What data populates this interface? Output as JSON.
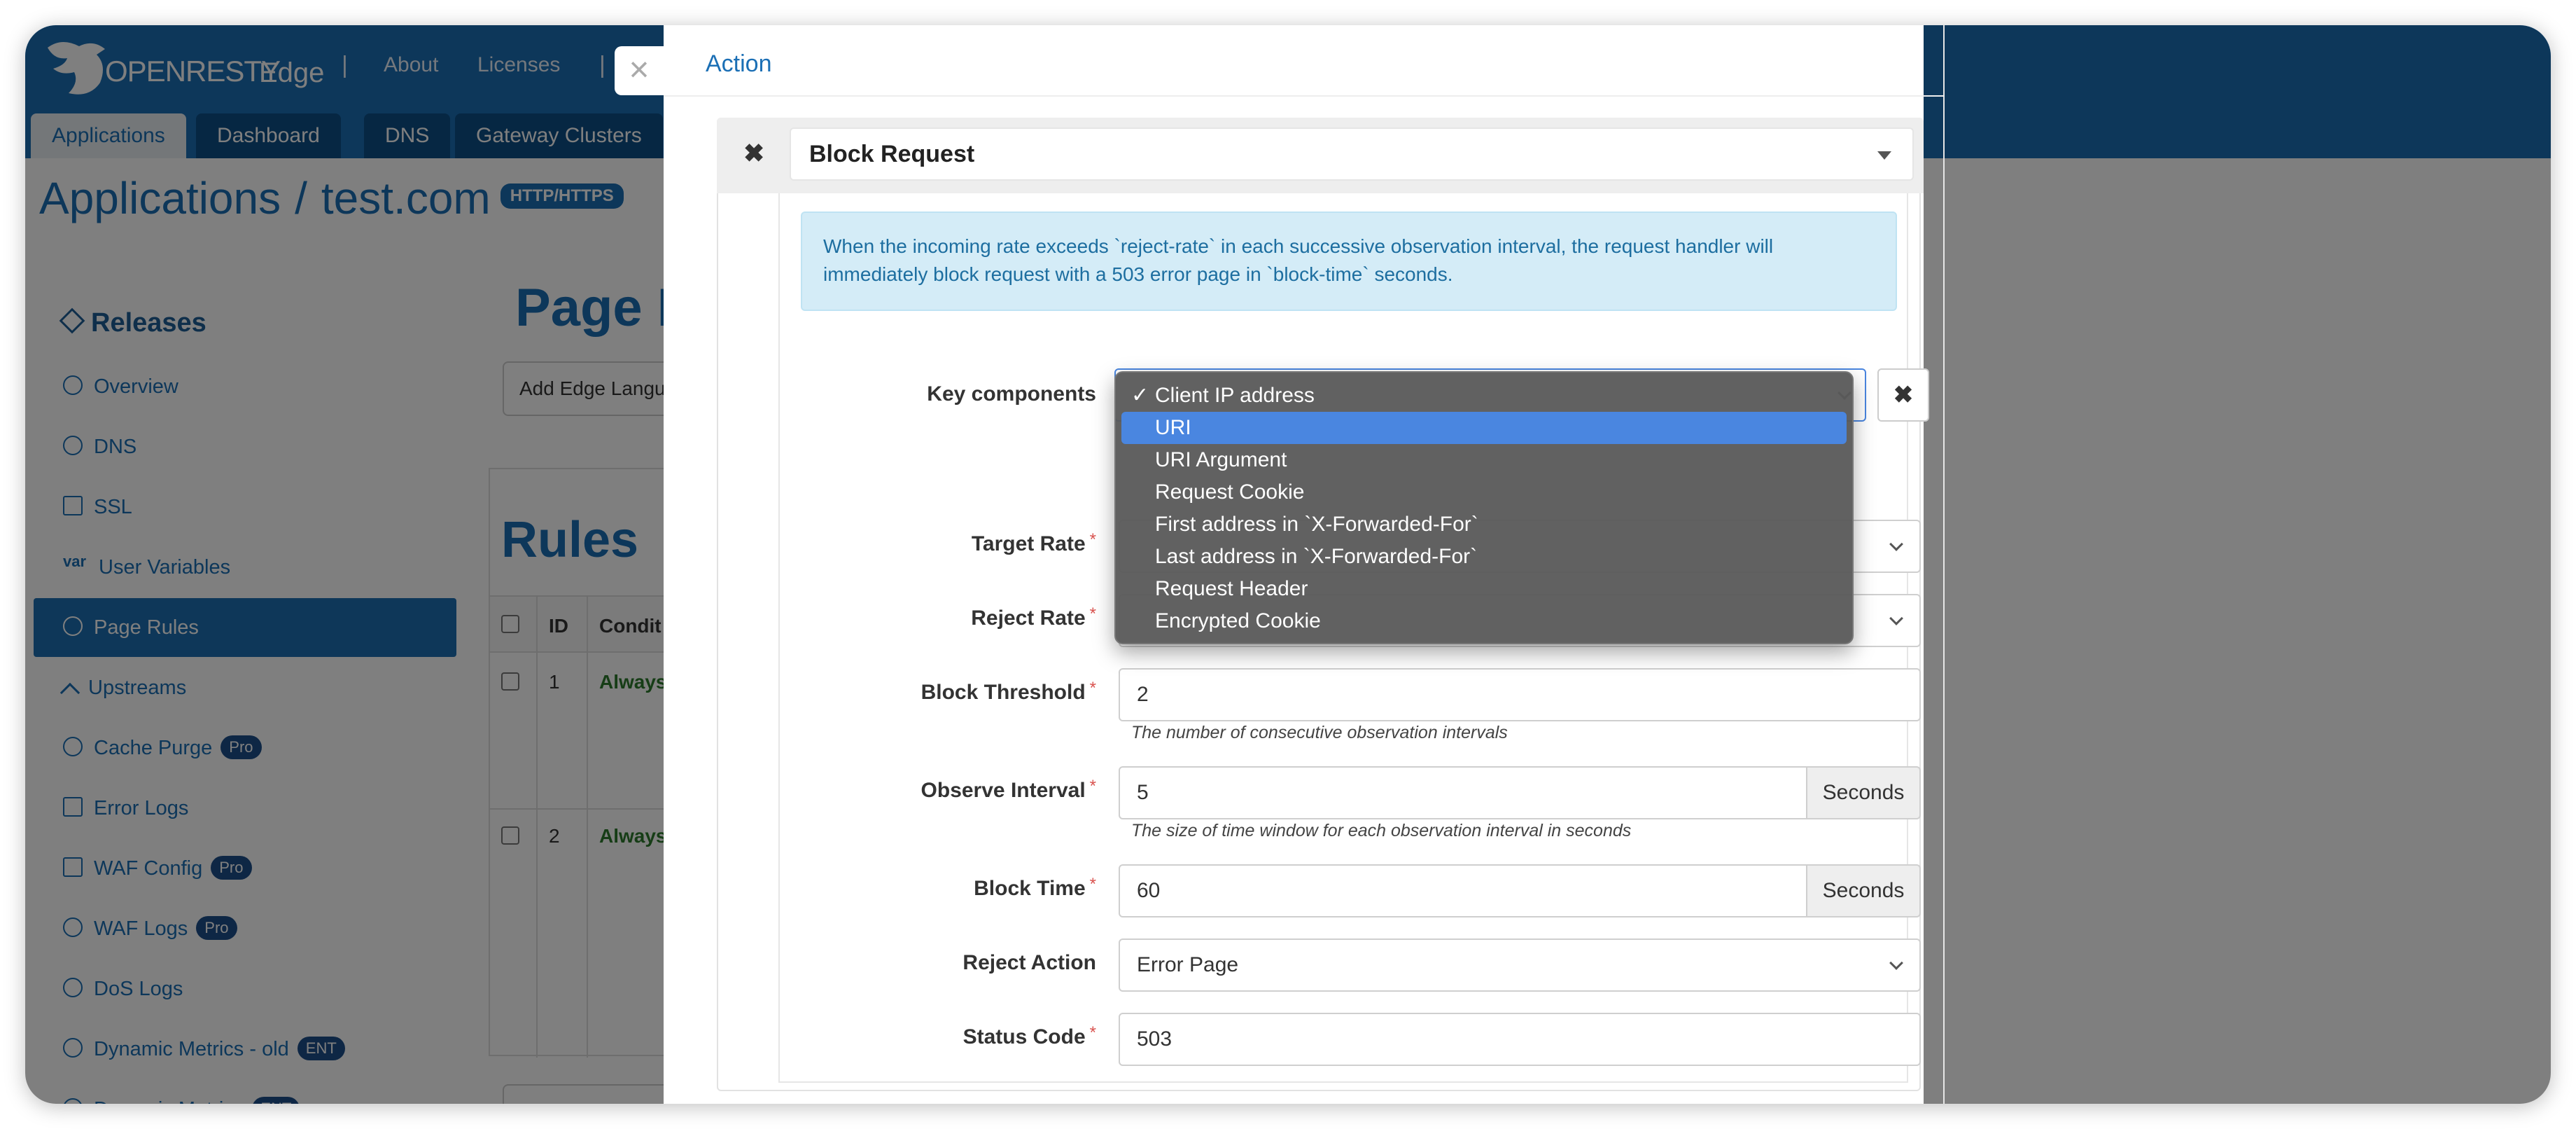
{
  "app": {
    "brand": "OPENRESTY",
    "brand_suffix": "Edge",
    "topnav": [
      "About",
      "Licenses"
    ],
    "tabs": [
      "Applications",
      "Dashboard",
      "DNS",
      "Gateway Clusters"
    ],
    "breadcrumb": {
      "root": "Applications",
      "separator": "/",
      "app": "test.com",
      "badge": "HTTP/HTTPS"
    },
    "sidebar": {
      "title": "Releases",
      "items": [
        {
          "label": "Overview"
        },
        {
          "label": "DNS"
        },
        {
          "label": "SSL"
        },
        {
          "label": "User Variables",
          "icon_text": "var"
        },
        {
          "label": "Page Rules",
          "active": true
        },
        {
          "label": "Upstreams"
        },
        {
          "label": "Cache Purge",
          "badge": "Pro"
        },
        {
          "label": "Error Logs"
        },
        {
          "label": "WAF Config",
          "badge": "Pro"
        },
        {
          "label": "WAF Logs",
          "badge": "Pro"
        },
        {
          "label": "DoS Logs"
        },
        {
          "label": "Dynamic Metrics - old",
          "badge": "ENT"
        },
        {
          "label": "Dynamic Metrics",
          "badge": "ENT"
        }
      ]
    },
    "page_title": "Page R",
    "add_button": "Add Edge Langu",
    "rules": {
      "title": "Rules",
      "headers": [
        "ID",
        "Condit"
      ],
      "rows": [
        {
          "id": "1",
          "condition": "Always"
        },
        {
          "id": "2",
          "condition": "Always"
        }
      ]
    }
  },
  "modal": {
    "close": "×",
    "title": "Action",
    "remove": "✖",
    "action_type": "Block Request",
    "info": "When the incoming rate exceeds `reject-rate` in each successive observation interval, the request handler will immediately block request with a 503 error page in `block-time` seconds.",
    "fields": {
      "key_components": {
        "label": "Key components",
        "remove": "✖"
      },
      "target_rate": {
        "label": "Target Rate",
        "required": "*"
      },
      "reject_rate": {
        "label": "Reject Rate",
        "required": "*"
      },
      "block_threshold": {
        "label": "Block Threshold",
        "required": "*",
        "value": "2",
        "help": "The number of consecutive observation intervals"
      },
      "observe_interval": {
        "label": "Observe Interval",
        "required": "*",
        "value": "5",
        "unit": "Seconds",
        "help": "The size of time window for each observation interval in seconds"
      },
      "block_time": {
        "label": "Block Time",
        "required": "*",
        "value": "60",
        "unit": "Seconds"
      },
      "reject_action": {
        "label": "Reject Action",
        "value": "Error Page"
      },
      "status_code": {
        "label": "Status Code",
        "required": "*",
        "value": "503"
      }
    },
    "dropdown": {
      "checkmark": "✓",
      "options": [
        "Client IP address",
        "URI",
        "URI Argument",
        "Request Cookie",
        "First address in `X-Forwarded-For`",
        "Last address in `X-Forwarded-For`",
        "Request Header",
        "Encrypted Cookie"
      ],
      "checked_index": 0,
      "highlighted_index": 1
    }
  }
}
